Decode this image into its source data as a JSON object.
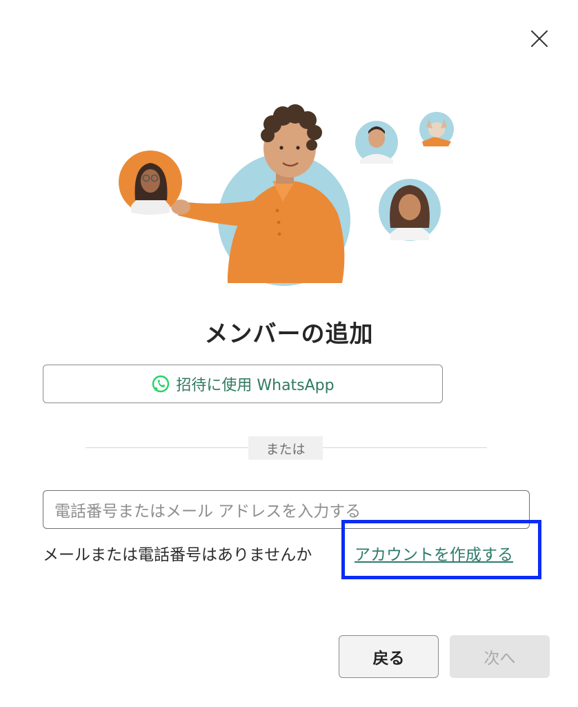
{
  "dialog": {
    "title": "メンバーの追加",
    "close_icon": "close-icon",
    "whatsapp": {
      "label": "招待に使用 WhatsApp",
      "icon": "whatsapp-icon",
      "color": "#2f7a5d"
    },
    "divider_label": "または",
    "contact_input": {
      "placeholder": "電話番号またはメール アドレスを入力する",
      "value": ""
    },
    "no_account_text": "メールまたは電話番号はありませんか",
    "create_account_link": "アカウントを作成する",
    "highlight_color": "#0a2cf5",
    "buttons": {
      "back": "戻る",
      "next": "次へ"
    },
    "accent_color": "#e98a35"
  }
}
